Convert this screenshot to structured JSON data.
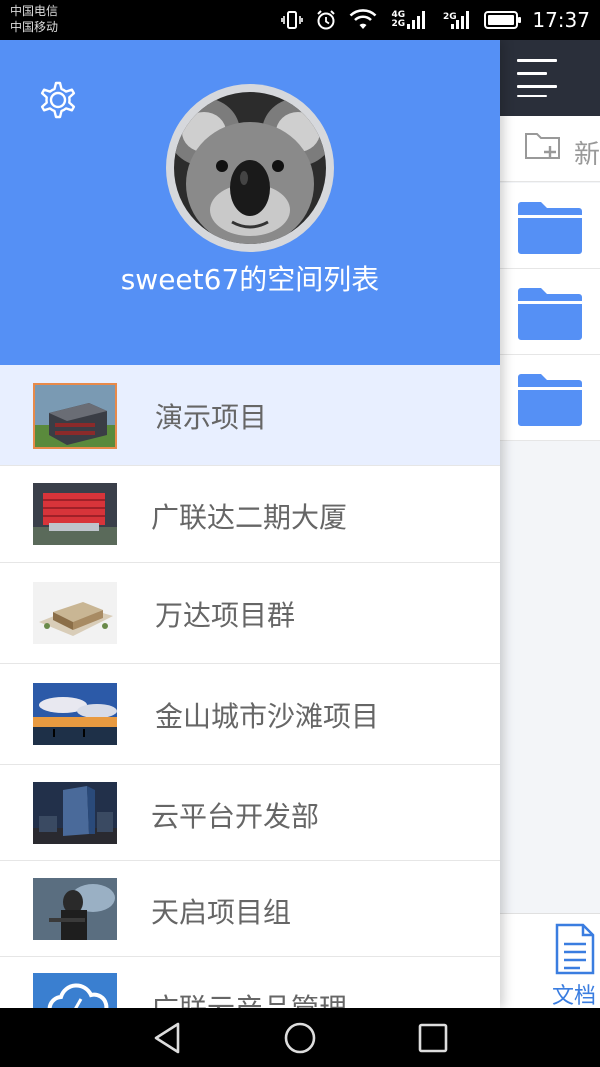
{
  "status_bar": {
    "carrier_1": "中国电信",
    "carrier_2": "中国移动",
    "network_1": "4G",
    "network_2": "2G",
    "time": "17:37",
    "icons": [
      "vibrate-icon",
      "alarm-icon",
      "wifi-icon",
      "signal-icon",
      "battery-icon"
    ]
  },
  "drawer": {
    "title": "sweet67的空间列表",
    "background_color": "#5590f5",
    "selected_color": "#e8efff",
    "projects": [
      {
        "name": "演示项目",
        "selected": true
      },
      {
        "name": "广联达二期大厦",
        "selected": false
      },
      {
        "name": "万达项目群",
        "selected": false
      },
      {
        "name": "金山城市沙滩项目",
        "selected": false
      },
      {
        "name": "云平台开发部",
        "selected": false
      },
      {
        "name": "天启项目组",
        "selected": false
      },
      {
        "name": "广联云产品管理",
        "selected": false
      }
    ]
  },
  "right_panel": {
    "new_folder_label": "新",
    "doc_tab_label": "文档",
    "accent_color": "#3a7de0"
  }
}
